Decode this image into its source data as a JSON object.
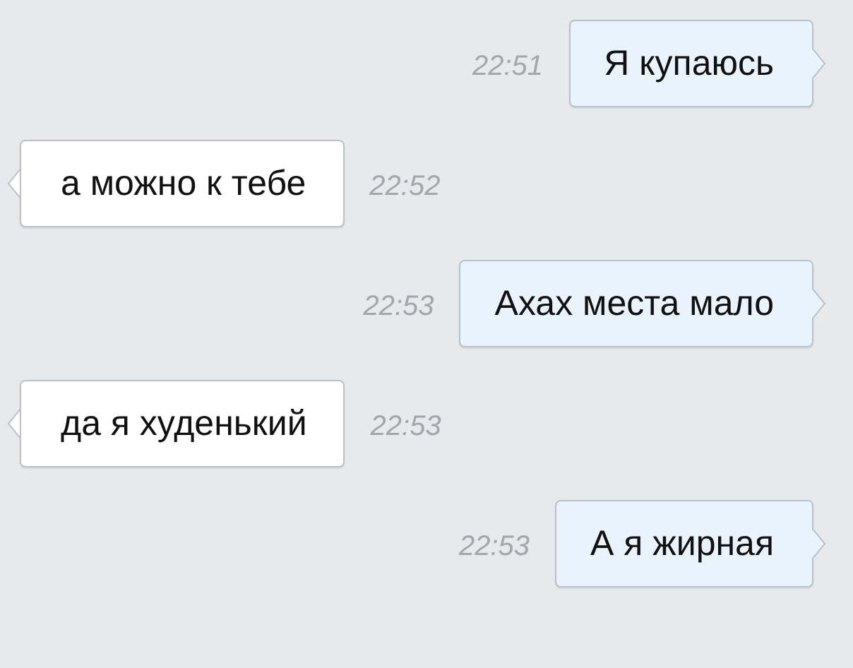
{
  "messages": [
    {
      "kind": "outgoing",
      "text": "Я купаюсь",
      "time": "22:51"
    },
    {
      "kind": "incoming",
      "text": "а можно к тебе",
      "time": "22:52"
    },
    {
      "kind": "outgoing",
      "text": "Ахах места мало",
      "time": "22:53"
    },
    {
      "kind": "incoming",
      "text": "да я худенький",
      "time": "22:53"
    },
    {
      "kind": "outgoing",
      "text": "А я жирная",
      "time": "22:53"
    }
  ]
}
